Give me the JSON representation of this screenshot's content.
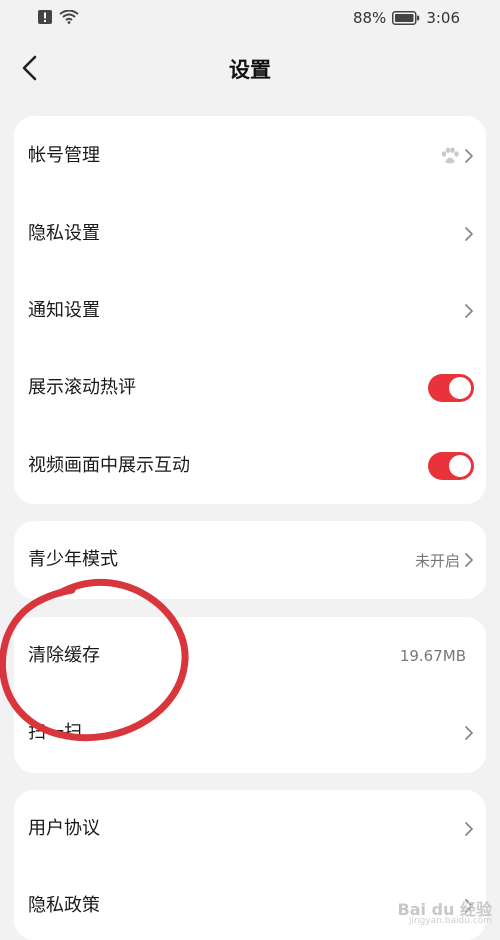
{
  "status_bar": {
    "battery_percent": "88%",
    "time": "3:06"
  },
  "header": {
    "title": "设置"
  },
  "card1": {
    "items": [
      {
        "label": "帐号管理",
        "icon": "paw-icon"
      },
      {
        "label": "隐私设置"
      },
      {
        "label": "通知设置"
      },
      {
        "label": "展示滚动热评",
        "toggle_on": true
      },
      {
        "label": "视频画面中展示互动",
        "toggle_on": true
      }
    ]
  },
  "card2": {
    "items": [
      {
        "label": "青少年模式",
        "value": "未开启"
      }
    ]
  },
  "card3": {
    "items": [
      {
        "label": "清除缓存",
        "value": "19.67MB"
      },
      {
        "label": "扫一扫"
      }
    ]
  },
  "card4": {
    "items": [
      {
        "label": "用户协议"
      },
      {
        "label": "隐私政策"
      }
    ]
  },
  "watermark": {
    "text": "Bai du 经验",
    "sub": "jingyan.baidu.com"
  },
  "colors": {
    "accent": "#e8333a",
    "annotation": "#d8353d"
  }
}
